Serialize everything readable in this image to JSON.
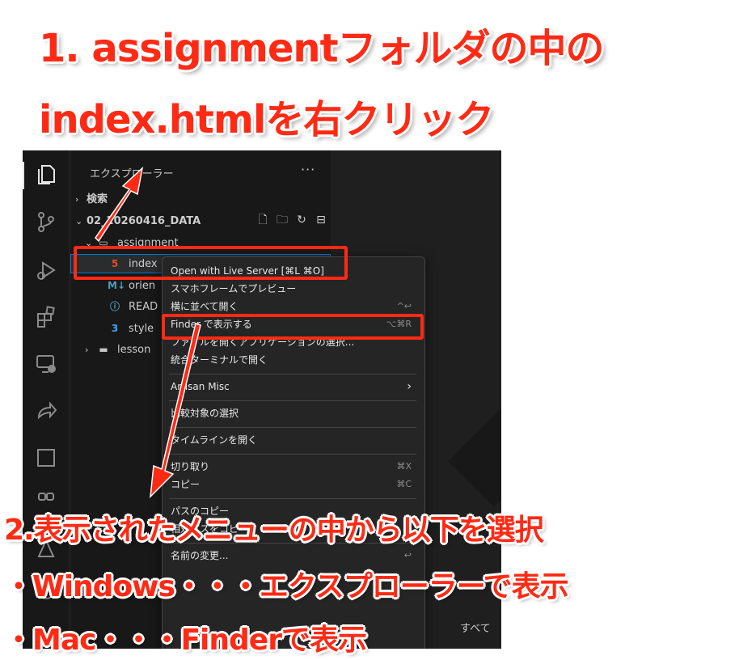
{
  "annotations": {
    "title_line1": "1. assignmentフォルダの中の",
    "title_line2": "index.htmlを右クリック",
    "instruction_line1": "2.表示されたメニューの中から以下を選択",
    "instruction_line2": "・Windows・・・エクスプローラーで表示",
    "instruction_line3": "・Mac・・・Finderで表示",
    "highlight_color": "#ff2a14"
  },
  "activity_bar": {
    "icons": [
      "files-icon",
      "source-control-icon",
      "run-debug-icon",
      "extensions-icon",
      "remote-explorer-icon",
      "live-share-icon",
      "stop-icon",
      "testing-icon",
      "git-icon",
      "account-icon"
    ]
  },
  "sidebar": {
    "title": "エクスプローラー",
    "more": "···",
    "search_section": "検索",
    "project_name": "02_20260416_DATA",
    "tree": [
      {
        "label": "assignment",
        "type": "folder-open"
      },
      {
        "label": "index",
        "type": "html-file"
      },
      {
        "label": "orien",
        "type": "md-file"
      },
      {
        "label": "READ",
        "type": "info-file"
      },
      {
        "label": "style",
        "type": "css-file"
      },
      {
        "label": "lesson",
        "type": "folder-closed"
      }
    ]
  },
  "context_menu": {
    "items": [
      {
        "label": "Open with Live Server [⌘L ⌘O]",
        "shortcut": ""
      },
      {
        "label": "スマホフレームでプレビュー",
        "shortcut": ""
      },
      {
        "label": "横に並べて開く",
        "shortcut": "^↩"
      },
      {
        "label": "Finder で表示する",
        "shortcut": "⌥⌘R"
      },
      {
        "label": "ファイルを開くアプリケーションの選択...",
        "shortcut": ""
      },
      {
        "label": "統合ターミナルで開く",
        "shortcut": ""
      },
      {
        "label": "Artisan Misc",
        "shortcut": "›"
      },
      {
        "label": "比較対象の選択",
        "shortcut": ""
      },
      {
        "label": "タイムラインを開く",
        "shortcut": ""
      },
      {
        "label": "切り取り",
        "shortcut": "⌘X"
      },
      {
        "label": "コピー",
        "shortcut": "⌘C"
      },
      {
        "label": "パスのコピー",
        "shortcut": ""
      },
      {
        "label": "相対パスをコピー",
        "shortcut": ""
      },
      {
        "label": "名前の変更...",
        "shortcut": "↩"
      }
    ]
  },
  "main": {
    "bottom_text": "すべて"
  }
}
